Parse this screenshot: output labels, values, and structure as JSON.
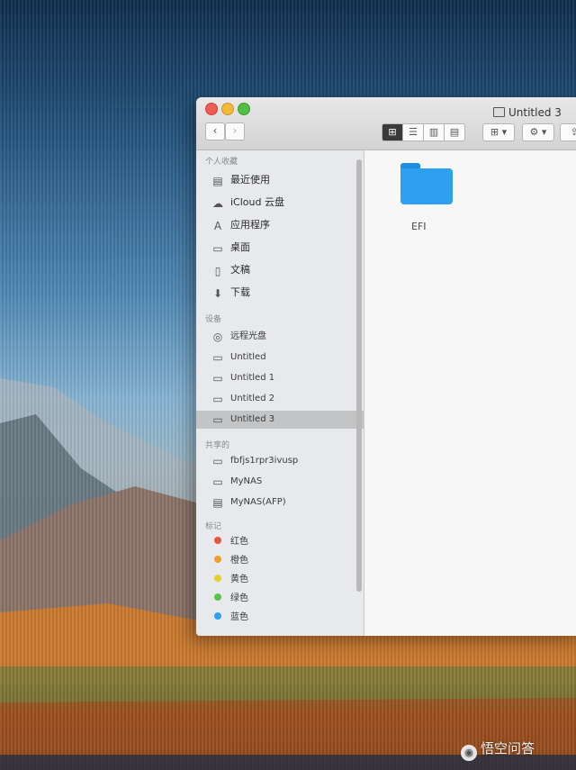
{
  "window": {
    "title": "Untitled 3",
    "colors": {
      "close": "#ee5c52",
      "minimize": "#f3b83c",
      "maximize": "#54bd45",
      "folder": "#2f9ff0"
    }
  },
  "toolbar": {
    "back_icon": "‹",
    "forward_icon": "›",
    "icon_view": "⊞",
    "list_view": "☰",
    "column_view": "▥",
    "cover_view": "▤",
    "arrange": "⊞ ▾",
    "action": "⚙ ▾",
    "share": "⇪"
  },
  "sidebar": {
    "favorites_header": "个人收藏",
    "favorites": [
      {
        "label": "最近使用",
        "icon": "recents-icon"
      },
      {
        "label": "iCloud 云盘",
        "icon": "cloud-icon"
      },
      {
        "label": "应用程序",
        "icon": "applications-icon"
      },
      {
        "label": "桌面",
        "icon": "desktop-icon"
      },
      {
        "label": "文稿",
        "icon": "documents-icon"
      },
      {
        "label": "下载",
        "icon": "downloads-icon"
      }
    ],
    "devices_header": "设备",
    "devices": [
      {
        "label": "远程光盘",
        "icon": "optical-disc-icon"
      },
      {
        "label": "Untitled",
        "icon": "disk-icon"
      },
      {
        "label": "Untitled 1",
        "icon": "disk-icon"
      },
      {
        "label": "Untitled 2",
        "icon": "disk-icon"
      },
      {
        "label": "Untitled 3",
        "icon": "disk-icon",
        "selected": true
      }
    ],
    "shared_header": "共享的",
    "shared": [
      {
        "label": "fbfjs1rpr3ivusp",
        "icon": "computer-icon"
      },
      {
        "label": "MyNAS",
        "icon": "computer-icon"
      },
      {
        "label": "MyNAS(AFP)",
        "icon": "server-icon"
      }
    ],
    "tags_header": "标记",
    "tags": [
      {
        "label": "红色",
        "color": "#e8553f"
      },
      {
        "label": "橙色",
        "color": "#f0a02a"
      },
      {
        "label": "黄色",
        "color": "#e6d12c"
      },
      {
        "label": "绿色",
        "color": "#5ac447"
      },
      {
        "label": "蓝色",
        "color": "#2f9ff0"
      }
    ]
  },
  "content": {
    "items": [
      {
        "label": "EFI",
        "icon": "folder-icon"
      }
    ]
  },
  "watermark": {
    "text": "悟空问答"
  }
}
